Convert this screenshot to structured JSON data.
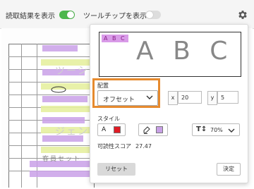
{
  "toolbar": {
    "show_results_label": "読取結果を表示",
    "show_results_on": true,
    "show_tooltip_label": "ツールチップを表示",
    "show_tooltip_on": false
  },
  "document": {
    "ghost_texts": [
      "ツーシス",
      "ジェント",
      "客員セット"
    ]
  },
  "panel": {
    "preview_tag": "A B C",
    "preview_text": "A B C",
    "placement_label": "配置",
    "placement_value": "オフセット",
    "x_label": "x",
    "x_value": "20",
    "y_label": "y",
    "y_value": "5",
    "style_label": "スタイル",
    "text_color_icon_label": "A",
    "text_color": "#e01b24",
    "highlight_color": "#c8a0e6",
    "font_size_value": "70%",
    "readability_label": "可読性スコア",
    "readability_value": "27.47",
    "reset_label": "リセット",
    "ok_label": "決定"
  },
  "colors": {
    "toggle_on": "#4cb74c",
    "highlight_frame": "#e68a2e"
  }
}
